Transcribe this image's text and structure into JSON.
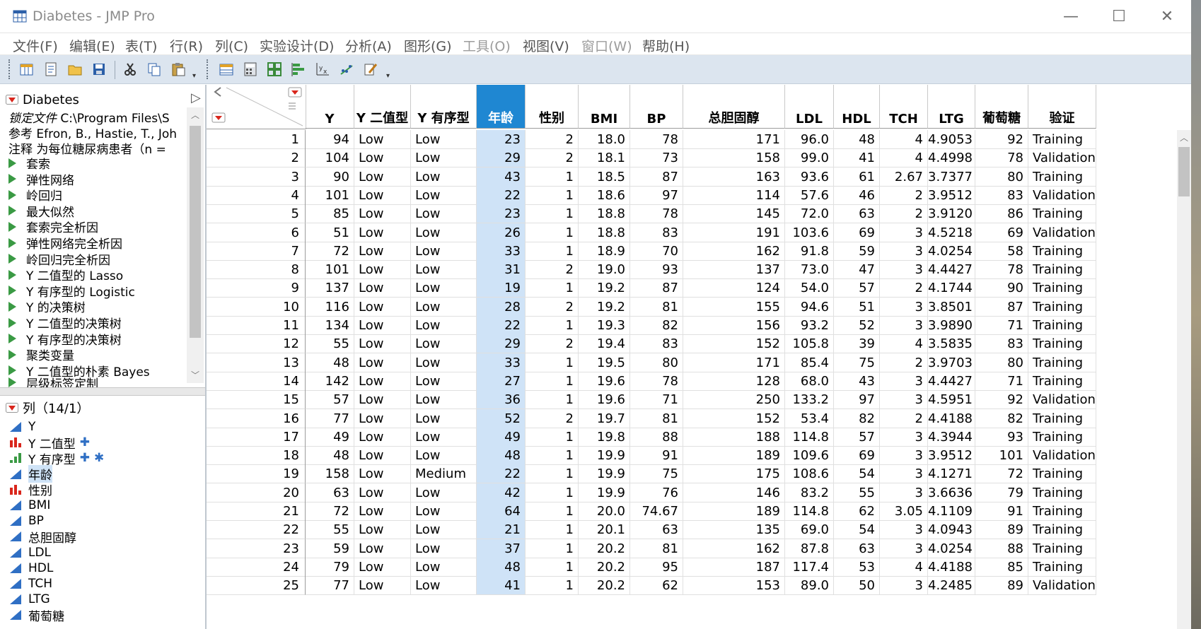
{
  "window": {
    "title": "Diabetes - JMP Pro"
  },
  "menu": [
    {
      "label": "文件(F)",
      "enabled": true
    },
    {
      "label": "编辑(E)",
      "enabled": true
    },
    {
      "label": "表(T)",
      "enabled": true
    },
    {
      "label": "行(R)",
      "enabled": true
    },
    {
      "label": "列(C)",
      "enabled": true
    },
    {
      "label": "实验设计(D)",
      "enabled": true
    },
    {
      "label": "分析(A)",
      "enabled": true
    },
    {
      "label": "图形(G)",
      "enabled": true
    },
    {
      "label": "工具(O)",
      "enabled": false
    },
    {
      "label": "视图(V)",
      "enabled": true
    },
    {
      "label": "窗口(W)",
      "enabled": false
    },
    {
      "label": "帮助(H)",
      "enabled": true
    }
  ],
  "table_panel": {
    "title": "Diabetes",
    "locked_label": "锁定文件",
    "locked_value": "C:\\Program Files\\S",
    "ref_label": "参考",
    "ref_value": "Efron, B., Hastie, T., Joh",
    "note_label": "注释",
    "note_value": "为每位糖尿病患者（n =",
    "scripts": [
      "套索",
      "弹性网络",
      "岭回归",
      "最大似然",
      "套索完全析因",
      "弹性网络完全析因",
      "岭回归完全析因",
      "Y 二值型的 Lasso",
      "Y 有序型的 Logistic",
      "Y 的决策树",
      "Y 二值型的决策树",
      "Y 有序型的决策树",
      "聚类变量",
      "Y 二值型的朴素 Bayes",
      "层级标签定制"
    ]
  },
  "columns_panel": {
    "title": "列（14/1）",
    "columns": [
      {
        "name": "Y",
        "type": "continuous",
        "extra": ""
      },
      {
        "name": "Y 二值型",
        "type": "nominal",
        "extra": "✚"
      },
      {
        "name": "Y 有序型",
        "type": "ordinal",
        "extra": "✚ ✱"
      },
      {
        "name": "年龄",
        "type": "continuous",
        "extra": "",
        "selected": true
      },
      {
        "name": "性别",
        "type": "nominal",
        "extra": ""
      },
      {
        "name": "BMI",
        "type": "continuous",
        "extra": ""
      },
      {
        "name": "BP",
        "type": "continuous",
        "extra": ""
      },
      {
        "name": "总胆固醇",
        "type": "continuous",
        "extra": ""
      },
      {
        "name": "LDL",
        "type": "continuous",
        "extra": ""
      },
      {
        "name": "HDL",
        "type": "continuous",
        "extra": ""
      },
      {
        "name": "TCH",
        "type": "continuous",
        "extra": ""
      },
      {
        "name": "LTG",
        "type": "continuous",
        "extra": ""
      },
      {
        "name": "葡萄糖",
        "type": "continuous",
        "extra": ""
      }
    ]
  },
  "grid": {
    "headers": [
      "Y",
      "Y 二值型",
      "Y 有序型",
      "年龄",
      "性别",
      "BMI",
      "BP",
      "总胆固醇",
      "LDL",
      "HDL",
      "TCH",
      "LTG",
      "葡萄糖",
      "验证"
    ],
    "selected_column": "年龄",
    "rows": [
      [
        "1",
        "94",
        "Low",
        "Low",
        "23",
        "2",
        "18.0",
        "78",
        "171",
        "96.0",
        "48",
        "4",
        "4.9053",
        "92",
        "Training"
      ],
      [
        "2",
        "104",
        "Low",
        "Low",
        "29",
        "2",
        "18.1",
        "73",
        "158",
        "99.0",
        "41",
        "4",
        "4.4998",
        "78",
        "Validation"
      ],
      [
        "3",
        "90",
        "Low",
        "Low",
        "43",
        "1",
        "18.5",
        "87",
        "163",
        "93.6",
        "61",
        "2.67",
        "3.7377",
        "80",
        "Training"
      ],
      [
        "4",
        "101",
        "Low",
        "Low",
        "22",
        "1",
        "18.6",
        "97",
        "114",
        "57.6",
        "46",
        "2",
        "3.9512",
        "83",
        "Validation"
      ],
      [
        "5",
        "85",
        "Low",
        "Low",
        "23",
        "1",
        "18.8",
        "78",
        "145",
        "72.0",
        "63",
        "2",
        "3.9120",
        "86",
        "Training"
      ],
      [
        "6",
        "51",
        "Low",
        "Low",
        "26",
        "1",
        "18.8",
        "83",
        "191",
        "103.6",
        "69",
        "3",
        "4.5218",
        "69",
        "Validation"
      ],
      [
        "7",
        "72",
        "Low",
        "Low",
        "33",
        "1",
        "18.9",
        "70",
        "162",
        "91.8",
        "59",
        "3",
        "4.0254",
        "58",
        "Training"
      ],
      [
        "8",
        "101",
        "Low",
        "Low",
        "31",
        "2",
        "19.0",
        "93",
        "137",
        "73.0",
        "47",
        "3",
        "4.4427",
        "78",
        "Training"
      ],
      [
        "9",
        "137",
        "Low",
        "Low",
        "19",
        "1",
        "19.2",
        "87",
        "124",
        "54.0",
        "57",
        "2",
        "4.1744",
        "90",
        "Training"
      ],
      [
        "10",
        "116",
        "Low",
        "Low",
        "28",
        "2",
        "19.2",
        "81",
        "155",
        "94.6",
        "51",
        "3",
        "3.8501",
        "87",
        "Training"
      ],
      [
        "11",
        "134",
        "Low",
        "Low",
        "22",
        "1",
        "19.3",
        "82",
        "156",
        "93.2",
        "52",
        "3",
        "3.9890",
        "71",
        "Training"
      ],
      [
        "12",
        "55",
        "Low",
        "Low",
        "29",
        "2",
        "19.4",
        "83",
        "152",
        "105.8",
        "39",
        "4",
        "3.5835",
        "83",
        "Training"
      ],
      [
        "13",
        "48",
        "Low",
        "Low",
        "33",
        "1",
        "19.5",
        "80",
        "171",
        "85.4",
        "75",
        "2",
        "3.9703",
        "80",
        "Training"
      ],
      [
        "14",
        "142",
        "Low",
        "Low",
        "27",
        "1",
        "19.6",
        "78",
        "128",
        "68.0",
        "43",
        "3",
        "4.4427",
        "71",
        "Training"
      ],
      [
        "15",
        "57",
        "Low",
        "Low",
        "36",
        "1",
        "19.6",
        "71",
        "250",
        "133.2",
        "97",
        "3",
        "4.5951",
        "92",
        "Validation"
      ],
      [
        "16",
        "77",
        "Low",
        "Low",
        "52",
        "2",
        "19.7",
        "81",
        "152",
        "53.4",
        "82",
        "2",
        "4.4188",
        "82",
        "Training"
      ],
      [
        "17",
        "49",
        "Low",
        "Low",
        "49",
        "1",
        "19.8",
        "88",
        "188",
        "114.8",
        "57",
        "3",
        "4.3944",
        "93",
        "Training"
      ],
      [
        "18",
        "48",
        "Low",
        "Low",
        "48",
        "1",
        "19.9",
        "91",
        "189",
        "109.6",
        "69",
        "3",
        "3.9512",
        "101",
        "Validation"
      ],
      [
        "19",
        "158",
        "Low",
        "Medium",
        "22",
        "1",
        "19.9",
        "75",
        "175",
        "108.6",
        "54",
        "3",
        "4.1271",
        "72",
        "Training"
      ],
      [
        "20",
        "63",
        "Low",
        "Low",
        "42",
        "1",
        "19.9",
        "76",
        "146",
        "83.2",
        "55",
        "3",
        "3.6636",
        "79",
        "Training"
      ],
      [
        "21",
        "72",
        "Low",
        "Low",
        "64",
        "1",
        "20.0",
        "74.67",
        "189",
        "114.8",
        "62",
        "3.05",
        "4.1109",
        "91",
        "Training"
      ],
      [
        "22",
        "55",
        "Low",
        "Low",
        "21",
        "1",
        "20.1",
        "63",
        "135",
        "69.0",
        "54",
        "3",
        "4.0943",
        "89",
        "Training"
      ],
      [
        "23",
        "59",
        "Low",
        "Low",
        "37",
        "1",
        "20.2",
        "81",
        "162",
        "87.8",
        "63",
        "3",
        "4.0254",
        "88",
        "Training"
      ],
      [
        "24",
        "79",
        "Low",
        "Low",
        "48",
        "1",
        "20.2",
        "95",
        "187",
        "117.4",
        "53",
        "4",
        "4.4188",
        "85",
        "Training"
      ],
      [
        "25",
        "77",
        "Low",
        "Low",
        "41",
        "1",
        "20.2",
        "62",
        "153",
        "89.0",
        "50",
        "3",
        "4.2485",
        "89",
        "Validation"
      ]
    ]
  },
  "colors": {
    "toolbar_bg": "#dce5ef",
    "selected_header": "#1f87d2",
    "selected_cell": "#cfe3f7",
    "script_triangle": "#3a9a44",
    "panel_triangle": "#d9261c"
  }
}
